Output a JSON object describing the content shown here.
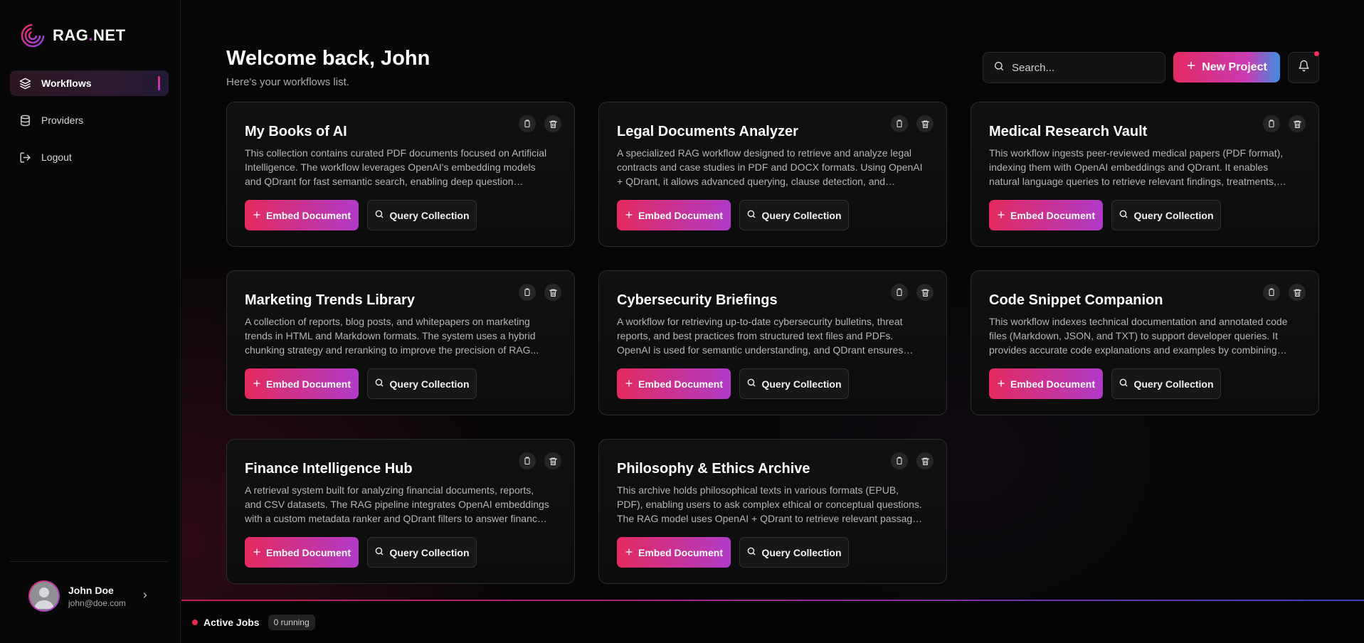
{
  "brand": {
    "name_prefix": "RAG",
    "name_dot": ".",
    "name_suffix": "NET"
  },
  "sidebar": {
    "items": [
      {
        "label": "Workflows",
        "icon": "layers-icon",
        "active": true
      },
      {
        "label": "Providers",
        "icon": "database-icon",
        "active": false
      },
      {
        "label": "Logout",
        "icon": "logout-icon",
        "active": false
      }
    ]
  },
  "user": {
    "name": "John Doe",
    "email": "john@doe.com"
  },
  "header": {
    "title": "Welcome back, John",
    "subtitle": "Here's your workflows list.",
    "search_placeholder": "Search...",
    "new_project_label": "New Project"
  },
  "card_labels": {
    "embed": "Embed Document",
    "query": "Query Collection"
  },
  "workflows": [
    {
      "title": "My Books of AI",
      "description": "This collection contains curated PDF documents focused on Artificial Intelligence. The workflow leverages OpenAI's embedding models and QDrant for fast semantic search, enabling deep question answering..."
    },
    {
      "title": "Legal Documents Analyzer",
      "description": "A specialized RAG workflow designed to retrieve and analyze legal contracts and case studies in PDF and DOCX formats. Using OpenAI + QDrant, it allows advanced querying, clause detection, and semantic..."
    },
    {
      "title": "Medical Research Vault",
      "description": "This workflow ingests peer-reviewed medical papers (PDF format), indexing them with OpenAI embeddings and QDrant. It enables natural language queries to retrieve relevant findings, treatments, an..."
    },
    {
      "title": "Marketing Trends Library",
      "description": "A collection of reports, blog posts, and whitepapers on marketing trends in HTML and Markdown formats. The system uses a hybrid chunking strategy and reranking to improve the precision of RAG..."
    },
    {
      "title": "Cybersecurity Briefings",
      "description": "A workflow for retrieving up-to-date cybersecurity bulletins, threat reports, and best practices from structured text files and PDFs. OpenAI is used for semantic understanding, and QDrant ensures high-speed..."
    },
    {
      "title": "Code Snippet Companion",
      "description": "This workflow indexes technical documentation and annotated code files (Markdown, JSON, and TXT) to support developer queries. It provides accurate code explanations and examples by combining GP..."
    },
    {
      "title": "Finance Intelligence Hub",
      "description": "A retrieval system built for analyzing financial documents, reports, and CSV datasets. The RAG pipeline integrates OpenAI embeddings with a custom metadata ranker and QDrant filters to answer finance-specific..."
    },
    {
      "title": "Philosophy & Ethics Archive",
      "description": "This archive holds philosophical texts in various formats (EPUB, PDF), enabling users to ask complex ethical or conceptual questions. The RAG model uses OpenAI + QDrant to retrieve relevant passages and..."
    }
  ],
  "footer": {
    "jobs_label": "Active Jobs",
    "jobs_count": "0 running"
  },
  "colors": {
    "accent_pink": "#e32a62",
    "accent_purple": "#b03bc8",
    "accent_blue": "#3d8fe0",
    "status_red": "#e8284f"
  }
}
